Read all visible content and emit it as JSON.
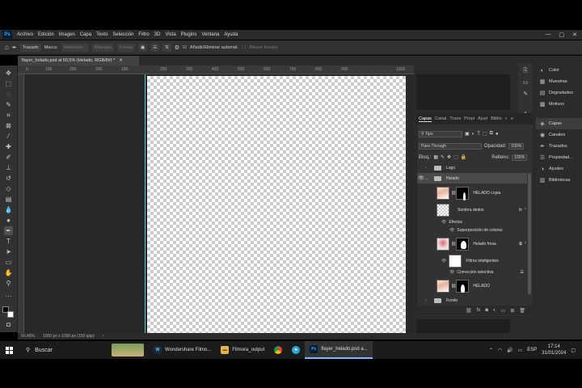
{
  "menubar": {
    "app_icon": "Ps",
    "items": [
      "Archivo",
      "Edición",
      "Imagen",
      "Capa",
      "Texto",
      "Selección",
      "Filtro",
      "3D",
      "Vista",
      "Plugins",
      "Ventana",
      "Ayuda"
    ]
  },
  "options": {
    "mode": "Trazado",
    "marca": "Marca:",
    "seleccion": "Selección...",
    "mascara": "Máscara",
    "forma": "Forma",
    "auto_add_delete": "Añadir/Eliminar automát.",
    "align_edges": "Alinear bordes"
  },
  "document": {
    "tab_title": "flayer_helado.psd al 60,5% (Helado, RGB/8#) *",
    "ruler_ticks": [
      "0",
      "100",
      "200",
      "300",
      "100",
      "200",
      "300",
      "400",
      "500",
      "600",
      "700",
      "800",
      "900",
      "1000"
    ]
  },
  "status": {
    "zoom": "60,46%",
    "size": "1000 px x 1000 px (150 ppp)"
  },
  "dock": {
    "group1": [
      "Color",
      "Muestras",
      "Degradados",
      "Motivos"
    ],
    "group2": [
      "Capas",
      "Canales",
      "Trazados",
      "Propiedad...",
      "Ajustes",
      "Bibliotecas"
    ]
  },
  "layers_panel": {
    "tabs": [
      "Capas",
      "Canal",
      "Traza",
      "Propi",
      "Ajust",
      "Biblio"
    ],
    "filter_kind": "Tipo",
    "blend_mode": "Pass Through",
    "opacity_label": "Opacidad:",
    "opacity_value": "100%",
    "lock_label": "Bloq.:",
    "fill_label": "Relleno:",
    "fill_value": "100%",
    "layers": [
      {
        "name": "Logo",
        "type": "group"
      },
      {
        "name": "Helado",
        "type": "group"
      },
      {
        "name": "HELADO copia",
        "type": "layer"
      },
      {
        "name": "Sombra dedos",
        "type": "layer",
        "fx": "fx"
      },
      {
        "name": "Efectos",
        "type": "effect"
      },
      {
        "name": "Superposición de colores",
        "type": "effect"
      },
      {
        "name": "Helado fresa",
        "type": "smart"
      },
      {
        "name": "Filtros inteligentes",
        "type": "effect"
      },
      {
        "name": "Corrección selectiva",
        "type": "effect"
      },
      {
        "name": "HELADO",
        "type": "layer"
      },
      {
        "name": "Fondo",
        "type": "group"
      }
    ]
  },
  "taskbar": {
    "search": "Buscar",
    "apps": [
      {
        "label": "Wondershare Filmo...",
        "icon": "W",
        "color": "#1b2b3f",
        "fg": "#5ad0ff"
      },
      {
        "label": "Filmora_output",
        "icon": "▬",
        "color": "#e8b24c",
        "fg": "#6a4a00"
      },
      {
        "label": "flayer_helado.psd a...",
        "icon": "Ps",
        "color": "#001e36",
        "fg": "#31a8ff"
      }
    ],
    "lang": "ESP",
    "time": "17:14",
    "date": "31/01/2024"
  }
}
